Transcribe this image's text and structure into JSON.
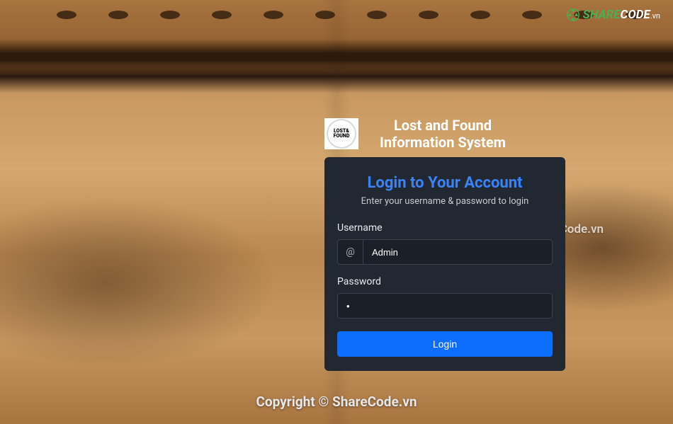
{
  "app": {
    "title_line1": "Lost and Found",
    "title_line2": "Information System",
    "logo_text_1": "LOST&",
    "logo_text_2": "FOUND"
  },
  "card": {
    "title": "Login to Your Account",
    "subtitle": "Enter your username & password to login"
  },
  "form": {
    "username_label": "Username",
    "username_addon": "@",
    "username_value": "Admin",
    "password_label": "Password",
    "password_value": "•",
    "login_button": "Login"
  },
  "watermark": {
    "share": "SHARE",
    "code": "CODE",
    "vn": ".vn",
    "center": "ShareCode.vn"
  },
  "footer": {
    "copyright": "Copyright © ShareCode.vn"
  }
}
